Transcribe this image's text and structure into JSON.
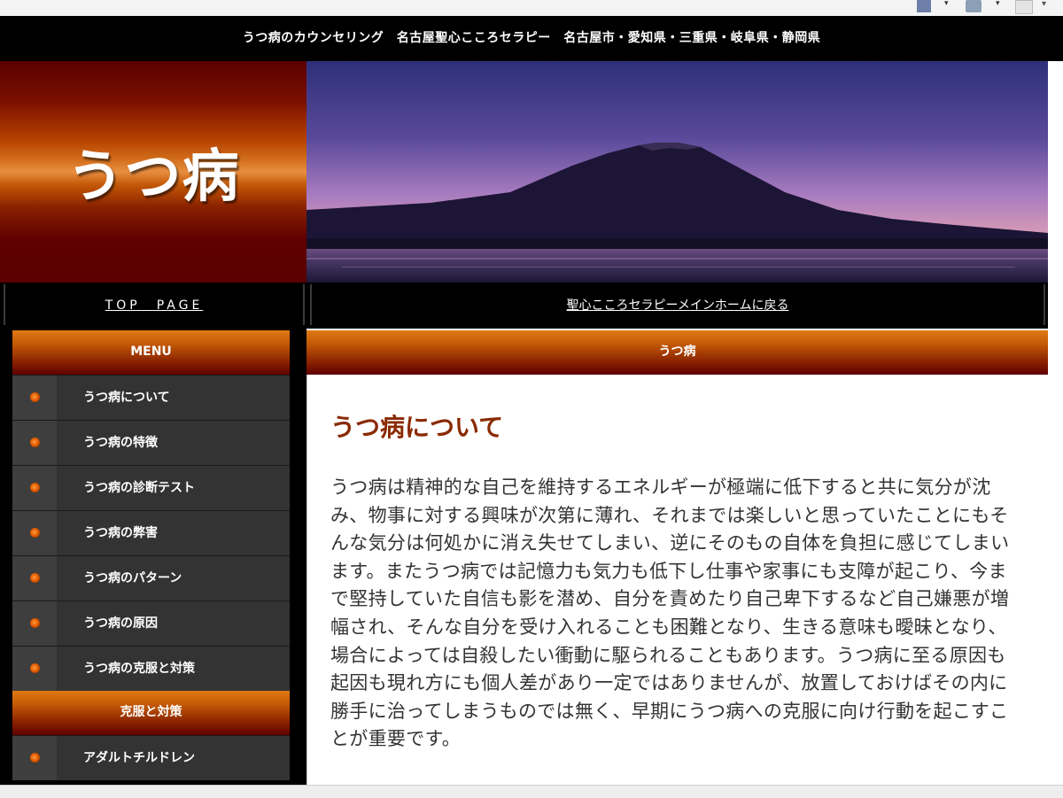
{
  "header": {
    "title": "うつ病のカウンセリング　名古屋聖心こころセラピー　名古屋市・愛知県・三重県・岐阜県・静岡県",
    "logo_text": "うつ病"
  },
  "nav": {
    "top_page": "TOP　PAGE",
    "main_home": "聖心こころセラピーメインホームに戻る"
  },
  "sidebar": {
    "menu_heading": "MENU",
    "items": [
      {
        "label": "うつ病について"
      },
      {
        "label": "うつ病の特徴"
      },
      {
        "label": "うつ病の診断テスト"
      },
      {
        "label": "うつ病の弊害"
      },
      {
        "label": "うつ病のパターン"
      },
      {
        "label": "うつ病の原因"
      },
      {
        "label": "うつ病の克服と対策"
      }
    ],
    "section2_heading": "克服と対策",
    "section2_items": [
      {
        "label": "アダルトチルドレン"
      }
    ]
  },
  "main": {
    "heading": "うつ病",
    "title": "うつ病について",
    "body": "うつ病は精神的な自己を維持するエネルギーが極端に低下すると共に気分が沈み、物事に対する興味が次第に薄れ、それまでは楽しいと思っていたことにもそんな気分は何処かに消え失せてしまい、逆にそのもの自体を負担に感じてしまいます。またうつ病では記憶力も気力も低下し仕事や家事にも支障が起こり、今まで堅持していた自信も影を潜め、自分を責めたり自己卑下するなど自己嫌悪が増幅され、そんな自分を受け入れることも困難となり、生きる意味も曖昧となり、場合によっては自殺したい衝動に駆られることもあります。うつ病に至る原因も起因も現れ方にも個人差があり一定ではありませんが、放置しておけばその内に勝手に治ってしまうものでは無く、早期にうつ病への克服に向け行動を起こすことが重要です。"
  },
  "colors": {
    "accent_orange": "#c45a07",
    "accent_dark_red": "#5e0000",
    "title_color": "#8a2a00",
    "sidebar_bg": "#333333"
  },
  "icons": [
    "page-icon",
    "feed-icon",
    "print-icon",
    "bullet-icon"
  ]
}
